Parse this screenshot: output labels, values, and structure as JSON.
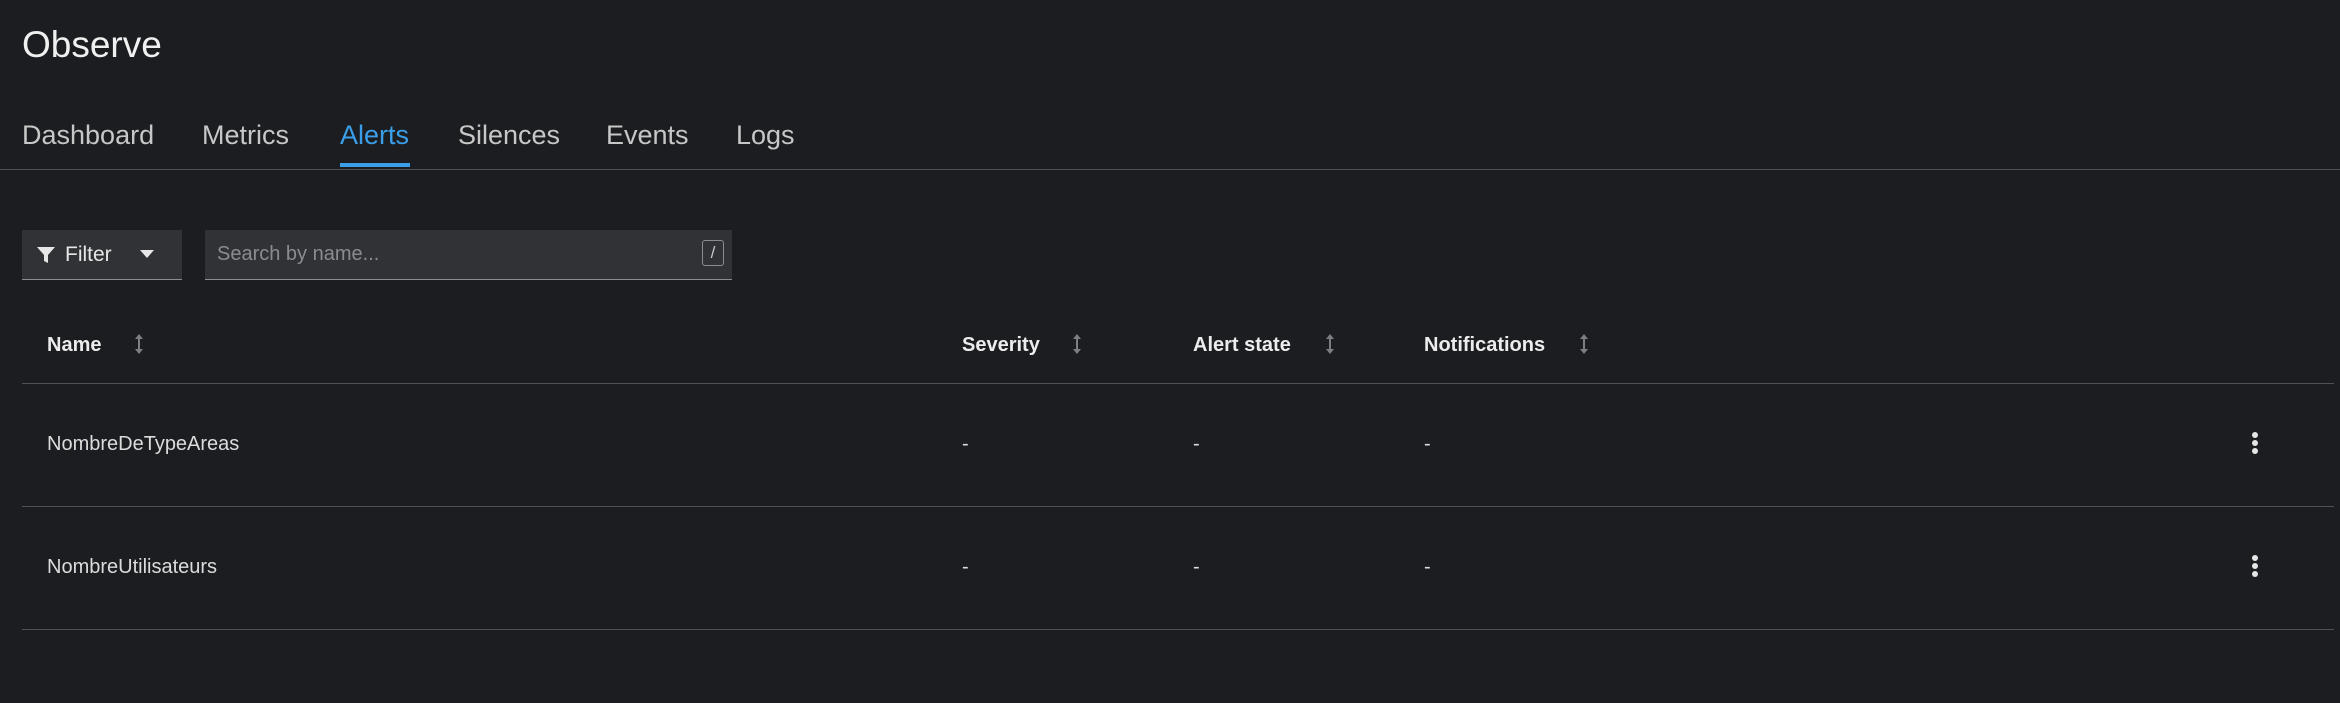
{
  "page": {
    "title": "Observe"
  },
  "tabs": [
    {
      "label": "Dashboard",
      "active": false
    },
    {
      "label": "Metrics",
      "active": false
    },
    {
      "label": "Alerts",
      "active": true
    },
    {
      "label": "Silences",
      "active": false
    },
    {
      "label": "Events",
      "active": false
    },
    {
      "label": "Logs",
      "active": false
    }
  ],
  "toolbar": {
    "filter_label": "Filter",
    "search_placeholder": "Search by name...",
    "search_value": "",
    "search_shortcut": "/"
  },
  "table": {
    "columns": [
      {
        "label": "Name",
        "sortable": true
      },
      {
        "label": "Severity",
        "sortable": true
      },
      {
        "label": "Alert state",
        "sortable": true
      },
      {
        "label": "Notifications",
        "sortable": true
      }
    ],
    "rows": [
      {
        "name": "NombreDeTypeAreas",
        "severity": "-",
        "alert_state": "-",
        "notifications": "-",
        "actions_icon": "kebab-icon"
      },
      {
        "name": "NombreUtilisateurs",
        "severity": "-",
        "alert_state": "-",
        "notifications": "-",
        "actions_icon": "kebab-icon"
      }
    ]
  },
  "colors": {
    "background": "#1b1d21",
    "accent": "#3a9fe8",
    "text": "#e0e0e0",
    "border": "#4f5255",
    "input_background": "#303236"
  },
  "icons": {
    "filter": "filter-icon",
    "caret": "caret-down-icon",
    "sort": "sort-icon",
    "row_actions": "kebab-icon"
  }
}
